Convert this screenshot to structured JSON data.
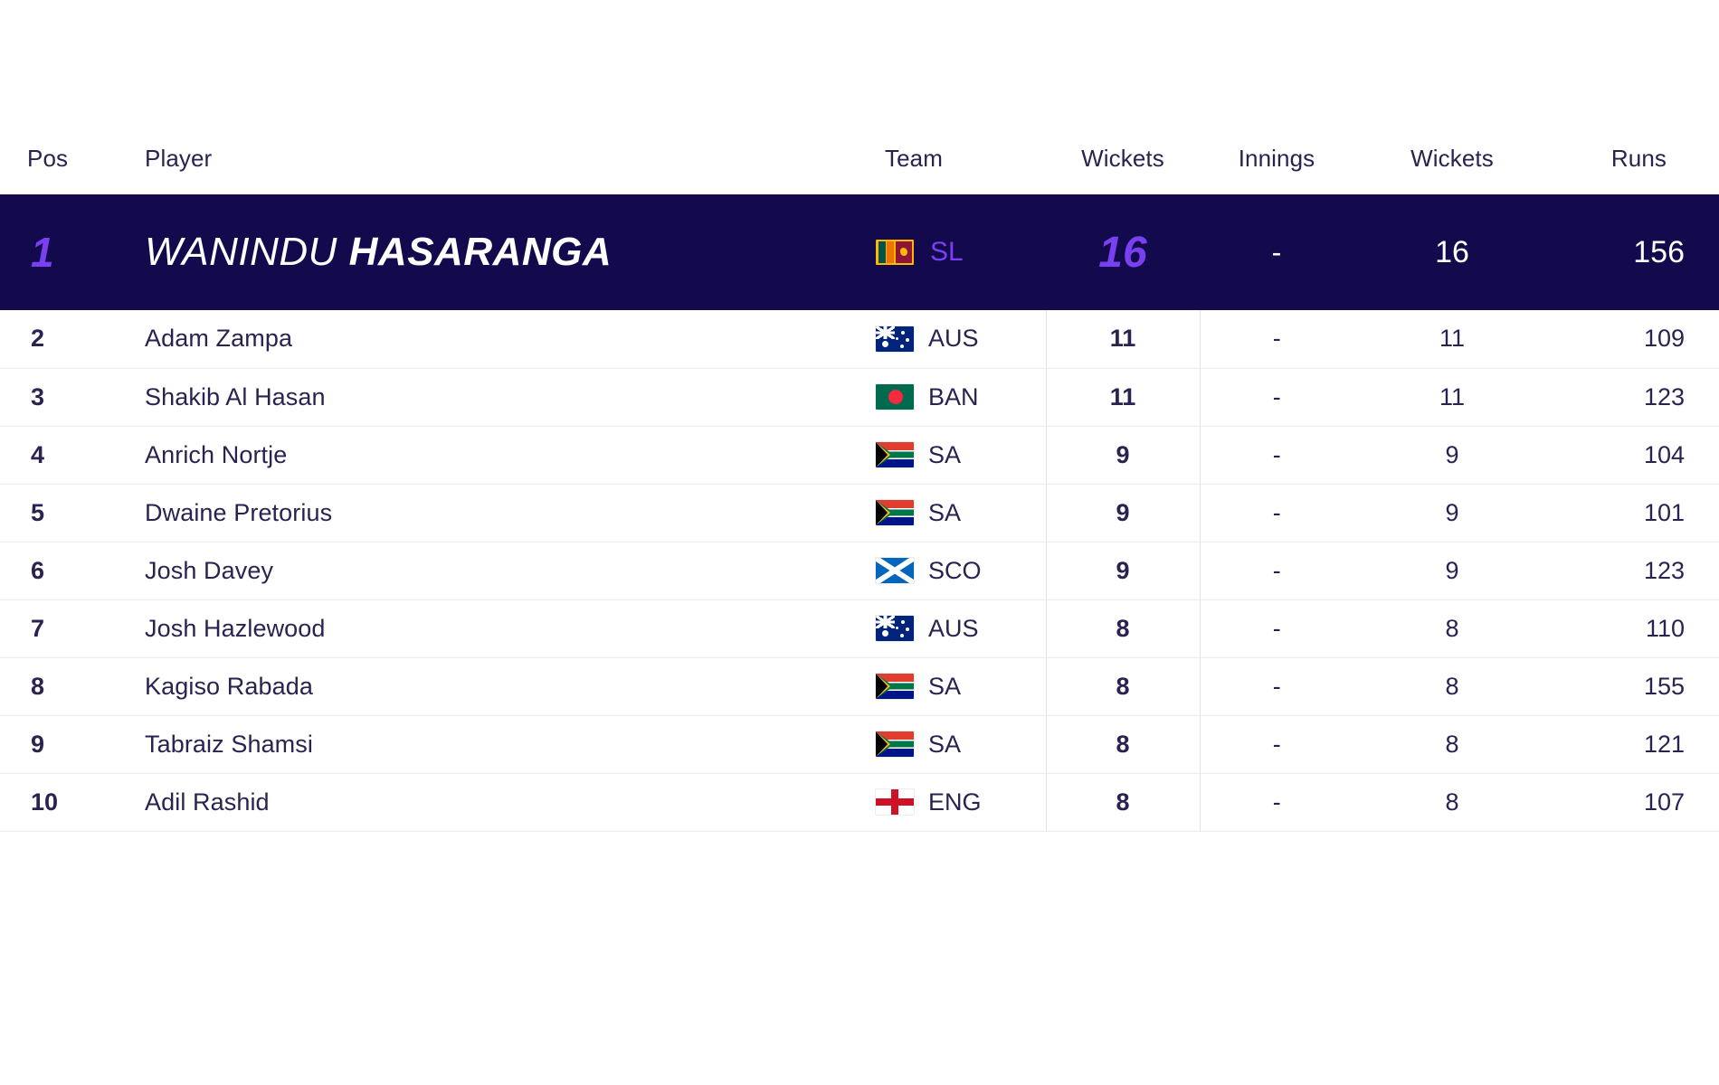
{
  "table": {
    "columns": [
      {
        "key": "pos",
        "label": "Pos"
      },
      {
        "key": "player",
        "label": "Player"
      },
      {
        "key": "team",
        "label": "Team"
      },
      {
        "key": "wickets",
        "label": "Wickets"
      },
      {
        "key": "innings",
        "label": "Innings"
      },
      {
        "key": "wickets2",
        "label": "Wickets"
      },
      {
        "key": "runs",
        "label": "Runs"
      }
    ],
    "featured": {
      "pos": "1",
      "player_first": "WANINDU",
      "player_last": "HASARANGA",
      "team_code": "SL",
      "team_flag": "flag-sri-lanka-icon",
      "wickets": "16",
      "innings": "-",
      "wickets2": "16",
      "runs": "156"
    },
    "rows": [
      {
        "pos": "2",
        "player": "Adam Zampa",
        "team_code": "AUS",
        "team_flag": "flag-australia-icon",
        "wickets": "11",
        "innings": "-",
        "wickets2": "11",
        "runs": "109"
      },
      {
        "pos": "3",
        "player": "Shakib Al Hasan",
        "team_code": "BAN",
        "team_flag": "flag-bangladesh-icon",
        "wickets": "11",
        "innings": "-",
        "wickets2": "11",
        "runs": "123"
      },
      {
        "pos": "4",
        "player": "Anrich Nortje",
        "team_code": "SA",
        "team_flag": "flag-south-africa-icon",
        "wickets": "9",
        "innings": "-",
        "wickets2": "9",
        "runs": "104"
      },
      {
        "pos": "5",
        "player": "Dwaine Pretorius",
        "team_code": "SA",
        "team_flag": "flag-south-africa-icon",
        "wickets": "9",
        "innings": "-",
        "wickets2": "9",
        "runs": "101"
      },
      {
        "pos": "6",
        "player": "Josh Davey",
        "team_code": "SCO",
        "team_flag": "flag-scotland-icon",
        "wickets": "9",
        "innings": "-",
        "wickets2": "9",
        "runs": "123"
      },
      {
        "pos": "7",
        "player": "Josh Hazlewood",
        "team_code": "AUS",
        "team_flag": "flag-australia-icon",
        "wickets": "8",
        "innings": "-",
        "wickets2": "8",
        "runs": "110"
      },
      {
        "pos": "8",
        "player": "Kagiso Rabada",
        "team_code": "SA",
        "team_flag": "flag-south-africa-icon",
        "wickets": "8",
        "innings": "-",
        "wickets2": "8",
        "runs": "155"
      },
      {
        "pos": "9",
        "player": "Tabraiz Shamsi",
        "team_code": "SA",
        "team_flag": "flag-south-africa-icon",
        "wickets": "8",
        "innings": "-",
        "wickets2": "8",
        "runs": "121"
      },
      {
        "pos": "10",
        "player": "Adil Rashid",
        "team_code": "ENG",
        "team_flag": "flag-england-icon",
        "wickets": "8",
        "innings": "-",
        "wickets2": "8",
        "runs": "107"
      }
    ]
  },
  "colors": {
    "featured_background": "#130a4e",
    "accent_purple": "#7b3ff2",
    "text_navy": "#2b2250",
    "row_divider": "#eceaf2",
    "page_background": "#ffffff"
  }
}
